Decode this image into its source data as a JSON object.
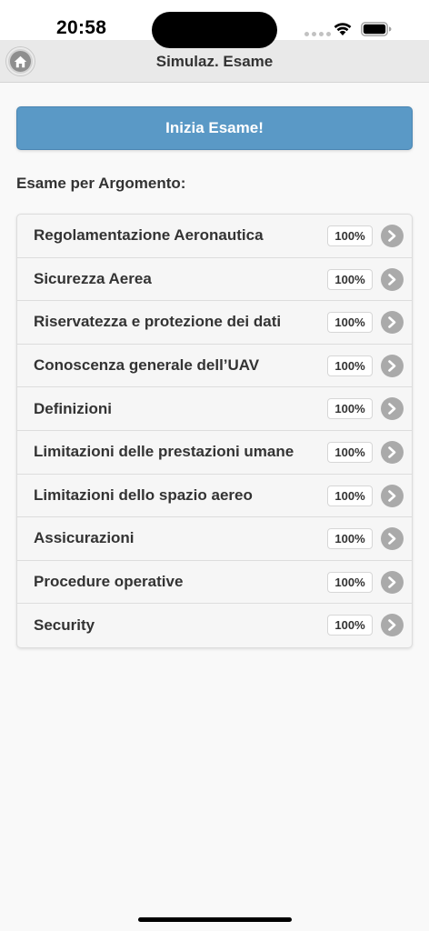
{
  "status_bar": {
    "time": "20:58"
  },
  "header": {
    "title": "Simulaz. Esame",
    "home_icon": "home-icon"
  },
  "start_button": {
    "label": "Inizia Esame!",
    "color": "#5a99c6"
  },
  "section": {
    "heading": "Esame per Argomento:"
  },
  "topics": [
    {
      "label": "Regolamentazione Aeronautica",
      "progress": "100%"
    },
    {
      "label": "Sicurezza Aerea",
      "progress": "100%"
    },
    {
      "label": "Riservatezza e protezione dei dati",
      "progress": "100%"
    },
    {
      "label": "Conoscenza generale dell’UAV",
      "progress": "100%"
    },
    {
      "label": "Definizioni",
      "progress": "100%"
    },
    {
      "label": "Limitazioni delle prestazioni umane",
      "progress": "100%"
    },
    {
      "label": "Limitazioni dello spazio aereo",
      "progress": "100%"
    },
    {
      "label": "Assicurazioni",
      "progress": "100%"
    },
    {
      "label": "Procedure operative",
      "progress": "100%"
    },
    {
      "label": "Security",
      "progress": "100%"
    }
  ],
  "icons": {
    "chevron": "chevron-right-icon",
    "wifi": "wifi-icon",
    "battery": "battery-icon"
  }
}
